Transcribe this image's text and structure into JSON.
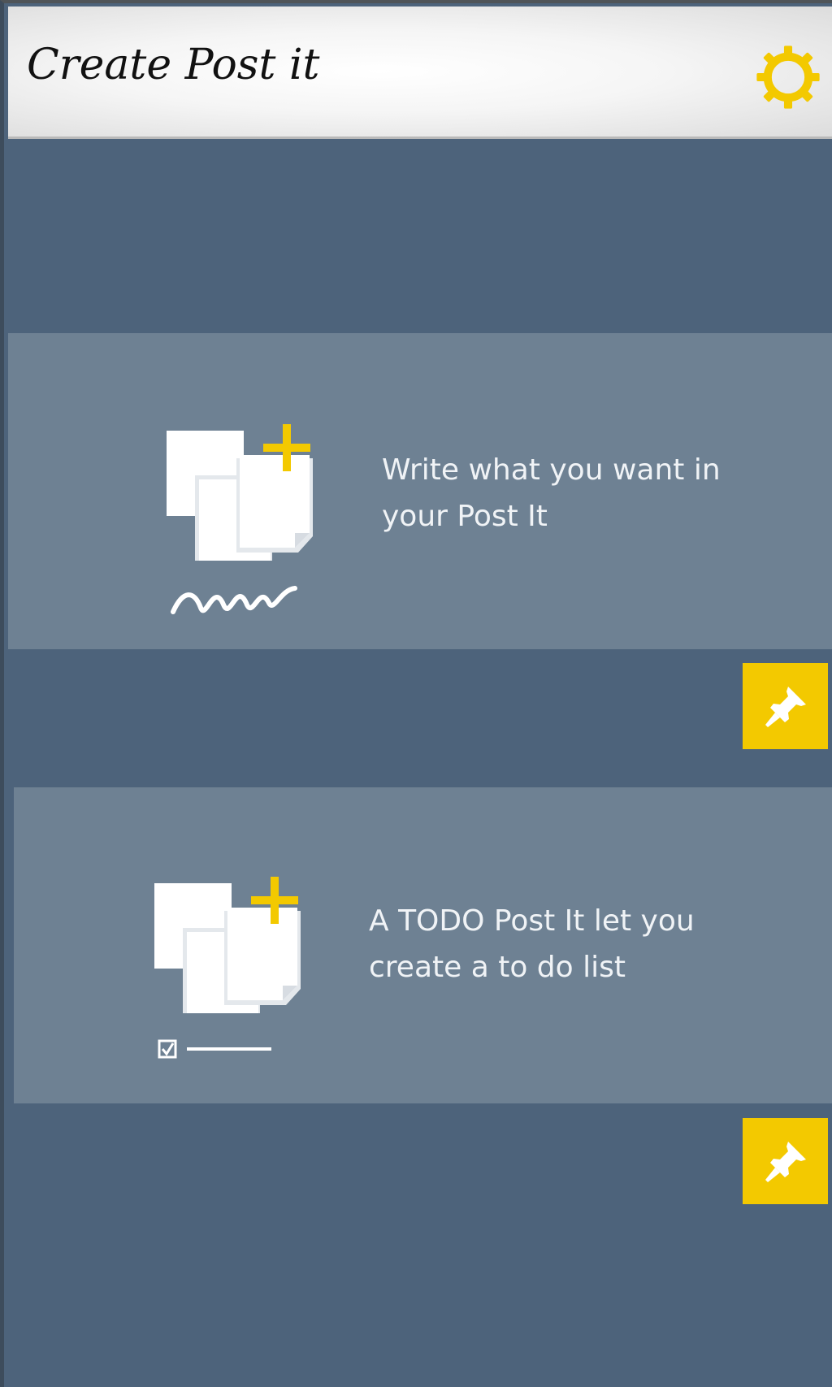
{
  "header": {
    "title": "Create Post it",
    "settings_icon": "gear-icon",
    "accent_color": "#f3c900"
  },
  "cards": [
    {
      "icon": "new-note-write-icon",
      "description": "Write what you want in your Post It",
      "pin_icon": "pin-icon"
    },
    {
      "icon": "new-note-todo-icon",
      "description": "A TODO Post It let you create a to do list",
      "pin_icon": "pin-icon"
    }
  ],
  "colors": {
    "background": "#4d637b",
    "card": "#6e8193",
    "header": "#f2f2f2"
  }
}
